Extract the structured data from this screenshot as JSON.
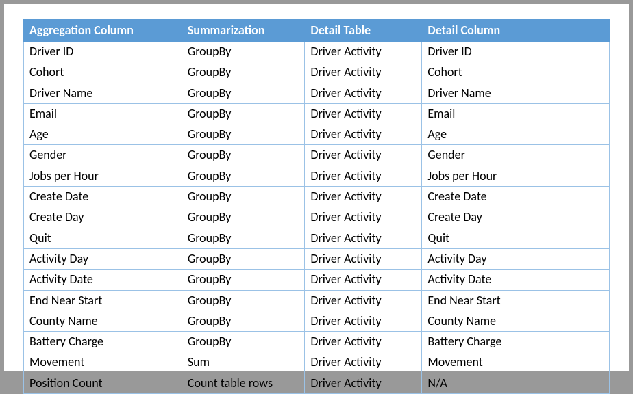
{
  "headers": {
    "c0": "Aggregation Column",
    "c1": "Summarization",
    "c2": "Detail Table",
    "c3": "Detail Column"
  },
  "rows": [
    {
      "c0": "Driver ID",
      "c1": "GroupBy",
      "c2": "Driver Activity",
      "c3": "Driver ID"
    },
    {
      "c0": "Cohort",
      "c1": "GroupBy",
      "c2": "Driver Activity",
      "c3": "Cohort"
    },
    {
      "c0": "Driver Name",
      "c1": "GroupBy",
      "c2": "Driver Activity",
      "c3": "Driver Name"
    },
    {
      "c0": "Email",
      "c1": "GroupBy",
      "c2": "Driver Activity",
      "c3": "Email"
    },
    {
      "c0": "Age",
      "c1": "GroupBy",
      "c2": "Driver Activity",
      "c3": "Age"
    },
    {
      "c0": "Gender",
      "c1": "GroupBy",
      "c2": "Driver Activity",
      "c3": "Gender"
    },
    {
      "c0": "Jobs per Hour",
      "c1": "GroupBy",
      "c2": "Driver Activity",
      "c3": "Jobs per Hour"
    },
    {
      "c0": "Create Date",
      "c1": "GroupBy",
      "c2": "Driver Activity",
      "c3": "Create Date"
    },
    {
      "c0": "Create Day",
      "c1": "GroupBy",
      "c2": "Driver Activity",
      "c3": "Create Day"
    },
    {
      "c0": "Quit",
      "c1": "GroupBy",
      "c2": "Driver Activity",
      "c3": "Quit"
    },
    {
      "c0": "Activity Day",
      "c1": "GroupBy",
      "c2": "Driver Activity",
      "c3": "Activity Day"
    },
    {
      "c0": "Activity Date",
      "c1": "GroupBy",
      "c2": "Driver Activity",
      "c3": "Activity Date"
    },
    {
      "c0": "End Near Start",
      "c1": "GroupBy",
      "c2": "Driver Activity",
      "c3": "End Near Start"
    },
    {
      "c0": "County Name",
      "c1": "GroupBy",
      "c2": "Driver Activity",
      "c3": "County Name"
    },
    {
      "c0": "Battery Charge",
      "c1": "GroupBy",
      "c2": "Driver Activity",
      "c3": "Battery Charge"
    },
    {
      "c0": "Movement",
      "c1": "Sum",
      "c2": "Driver Activity",
      "c3": "Movement"
    },
    {
      "c0": "Position Count",
      "c1": "Count table rows",
      "c2": "Driver Activity",
      "c3": "N/A"
    }
  ]
}
